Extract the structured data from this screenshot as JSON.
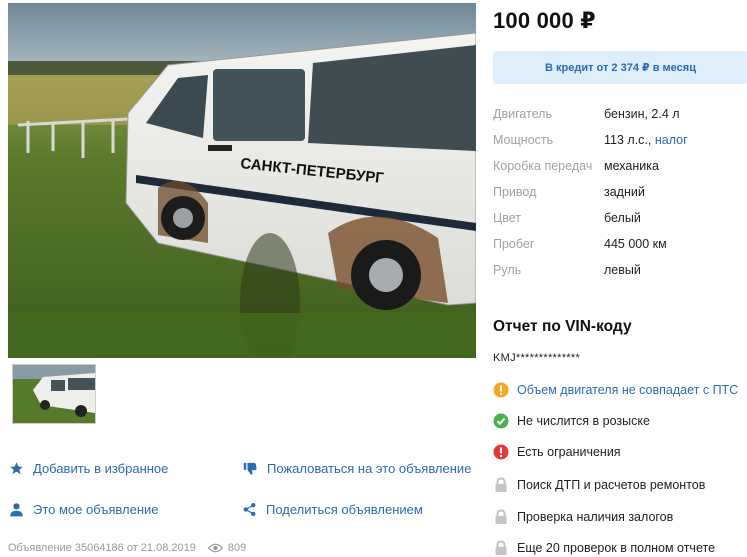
{
  "photo": {
    "side_text": "САНКТ-ПЕТЕРБУРГ"
  },
  "actions": {
    "favorite": "Добавить в избранное",
    "complain": "Пожаловаться на это объявление",
    "my_ad": "Это мое объявление",
    "share": "Поделиться объявлением"
  },
  "meta": {
    "ad_info": "Объявление 35064186 от 21.08.2019",
    "views": "809"
  },
  "price": "100 000 ₽",
  "credit": "В кредит от 2 374 ₽ в месяц",
  "specs": [
    {
      "key": "Двигатель",
      "value": "бензин, 2.4 л"
    },
    {
      "key": "Мощность",
      "value": "113 л.с.,",
      "link": "налог"
    },
    {
      "key": "Коробка передач",
      "value": "механика"
    },
    {
      "key": "Привод",
      "value": "задний"
    },
    {
      "key": "Цвет",
      "value": "белый"
    },
    {
      "key": "Пробег",
      "value": "445 000 км"
    },
    {
      "key": "Руль",
      "value": "левый"
    }
  ],
  "vin": {
    "title": "Отчет по VIN-коду",
    "code": "KMJ**************"
  },
  "checks": [
    {
      "text": "Объем двигателя не совпадает с ПТС",
      "icon": "warning-icon",
      "color": "#f5a623"
    },
    {
      "text": "Не числится в розыске",
      "icon": "check-circle-icon",
      "color": "#4caf50"
    },
    {
      "text": "Есть ограничения",
      "icon": "error-icon",
      "color": "#e53935"
    },
    {
      "text": "Поиск ДТП и расчетов ремонтов",
      "icon": "lock-icon",
      "color": "#bdbdbd"
    },
    {
      "text": "Проверка наличия залогов",
      "icon": "lock-icon",
      "color": "#bdbdbd"
    },
    {
      "text": "Еще 20 проверок в полном отчете",
      "icon": "lock-icon",
      "color": "#bdbdbd"
    }
  ],
  "colors": {
    "link": "#2e6ab1",
    "credit_bg": "#dfeefb"
  }
}
